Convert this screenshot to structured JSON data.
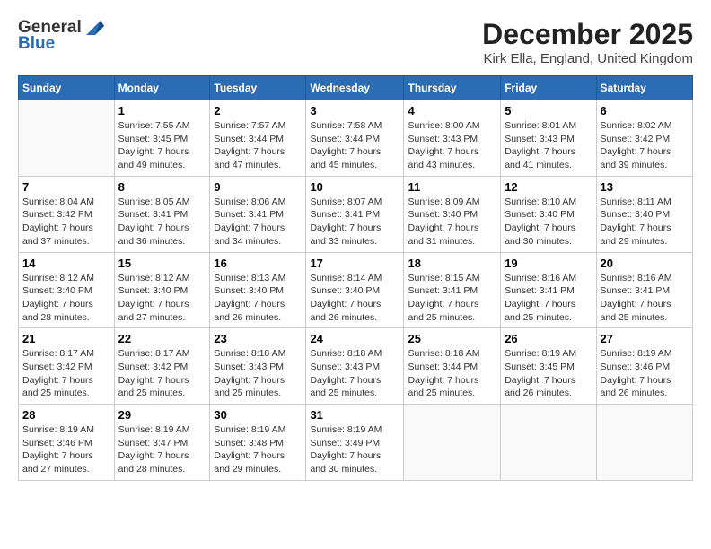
{
  "logo": {
    "general": "General",
    "blue": "Blue"
  },
  "title": "December 2025",
  "location": "Kirk Ella, England, United Kingdom",
  "days_of_week": [
    "Sunday",
    "Monday",
    "Tuesday",
    "Wednesday",
    "Thursday",
    "Friday",
    "Saturday"
  ],
  "weeks": [
    [
      {
        "day": "",
        "info": ""
      },
      {
        "day": "1",
        "info": "Sunrise: 7:55 AM\nSunset: 3:45 PM\nDaylight: 7 hours\nand 49 minutes."
      },
      {
        "day": "2",
        "info": "Sunrise: 7:57 AM\nSunset: 3:44 PM\nDaylight: 7 hours\nand 47 minutes."
      },
      {
        "day": "3",
        "info": "Sunrise: 7:58 AM\nSunset: 3:44 PM\nDaylight: 7 hours\nand 45 minutes."
      },
      {
        "day": "4",
        "info": "Sunrise: 8:00 AM\nSunset: 3:43 PM\nDaylight: 7 hours\nand 43 minutes."
      },
      {
        "day": "5",
        "info": "Sunrise: 8:01 AM\nSunset: 3:43 PM\nDaylight: 7 hours\nand 41 minutes."
      },
      {
        "day": "6",
        "info": "Sunrise: 8:02 AM\nSunset: 3:42 PM\nDaylight: 7 hours\nand 39 minutes."
      }
    ],
    [
      {
        "day": "7",
        "info": "Sunrise: 8:04 AM\nSunset: 3:42 PM\nDaylight: 7 hours\nand 37 minutes."
      },
      {
        "day": "8",
        "info": "Sunrise: 8:05 AM\nSunset: 3:41 PM\nDaylight: 7 hours\nand 36 minutes."
      },
      {
        "day": "9",
        "info": "Sunrise: 8:06 AM\nSunset: 3:41 PM\nDaylight: 7 hours\nand 34 minutes."
      },
      {
        "day": "10",
        "info": "Sunrise: 8:07 AM\nSunset: 3:41 PM\nDaylight: 7 hours\nand 33 minutes."
      },
      {
        "day": "11",
        "info": "Sunrise: 8:09 AM\nSunset: 3:40 PM\nDaylight: 7 hours\nand 31 minutes."
      },
      {
        "day": "12",
        "info": "Sunrise: 8:10 AM\nSunset: 3:40 PM\nDaylight: 7 hours\nand 30 minutes."
      },
      {
        "day": "13",
        "info": "Sunrise: 8:11 AM\nSunset: 3:40 PM\nDaylight: 7 hours\nand 29 minutes."
      }
    ],
    [
      {
        "day": "14",
        "info": "Sunrise: 8:12 AM\nSunset: 3:40 PM\nDaylight: 7 hours\nand 28 minutes."
      },
      {
        "day": "15",
        "info": "Sunrise: 8:12 AM\nSunset: 3:40 PM\nDaylight: 7 hours\nand 27 minutes."
      },
      {
        "day": "16",
        "info": "Sunrise: 8:13 AM\nSunset: 3:40 PM\nDaylight: 7 hours\nand 26 minutes."
      },
      {
        "day": "17",
        "info": "Sunrise: 8:14 AM\nSunset: 3:40 PM\nDaylight: 7 hours\nand 26 minutes."
      },
      {
        "day": "18",
        "info": "Sunrise: 8:15 AM\nSunset: 3:41 PM\nDaylight: 7 hours\nand 25 minutes."
      },
      {
        "day": "19",
        "info": "Sunrise: 8:16 AM\nSunset: 3:41 PM\nDaylight: 7 hours\nand 25 minutes."
      },
      {
        "day": "20",
        "info": "Sunrise: 8:16 AM\nSunset: 3:41 PM\nDaylight: 7 hours\nand 25 minutes."
      }
    ],
    [
      {
        "day": "21",
        "info": "Sunrise: 8:17 AM\nSunset: 3:42 PM\nDaylight: 7 hours\nand 25 minutes."
      },
      {
        "day": "22",
        "info": "Sunrise: 8:17 AM\nSunset: 3:42 PM\nDaylight: 7 hours\nand 25 minutes."
      },
      {
        "day": "23",
        "info": "Sunrise: 8:18 AM\nSunset: 3:43 PM\nDaylight: 7 hours\nand 25 minutes."
      },
      {
        "day": "24",
        "info": "Sunrise: 8:18 AM\nSunset: 3:43 PM\nDaylight: 7 hours\nand 25 minutes."
      },
      {
        "day": "25",
        "info": "Sunrise: 8:18 AM\nSunset: 3:44 PM\nDaylight: 7 hours\nand 25 minutes."
      },
      {
        "day": "26",
        "info": "Sunrise: 8:19 AM\nSunset: 3:45 PM\nDaylight: 7 hours\nand 26 minutes."
      },
      {
        "day": "27",
        "info": "Sunrise: 8:19 AM\nSunset: 3:46 PM\nDaylight: 7 hours\nand 26 minutes."
      }
    ],
    [
      {
        "day": "28",
        "info": "Sunrise: 8:19 AM\nSunset: 3:46 PM\nDaylight: 7 hours\nand 27 minutes."
      },
      {
        "day": "29",
        "info": "Sunrise: 8:19 AM\nSunset: 3:47 PM\nDaylight: 7 hours\nand 28 minutes."
      },
      {
        "day": "30",
        "info": "Sunrise: 8:19 AM\nSunset: 3:48 PM\nDaylight: 7 hours\nand 29 minutes."
      },
      {
        "day": "31",
        "info": "Sunrise: 8:19 AM\nSunset: 3:49 PM\nDaylight: 7 hours\nand 30 minutes."
      },
      {
        "day": "",
        "info": ""
      },
      {
        "day": "",
        "info": ""
      },
      {
        "day": "",
        "info": ""
      }
    ]
  ]
}
